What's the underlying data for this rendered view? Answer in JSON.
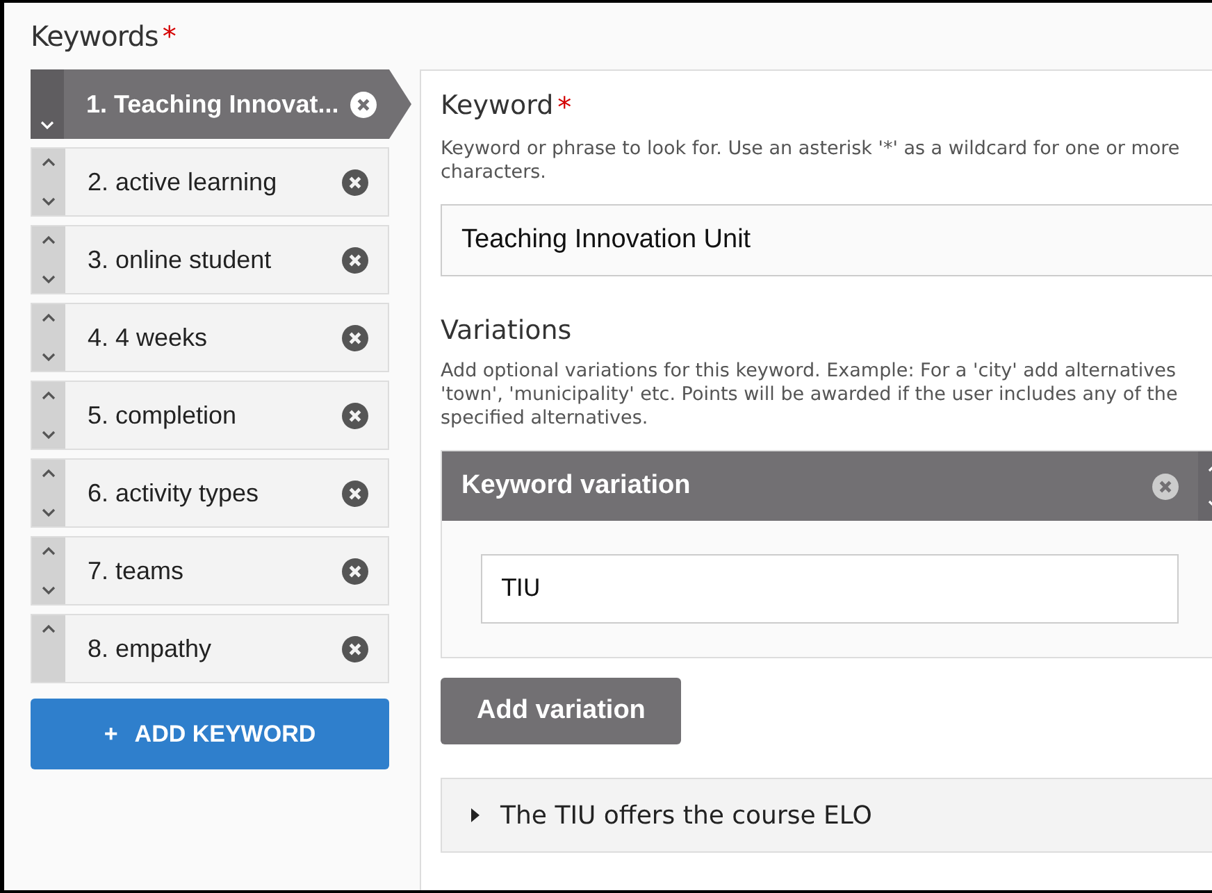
{
  "title": "Keywords",
  "required_mark": "*",
  "keywords": [
    {
      "label": "1. Teaching Innovat...",
      "selected": true
    },
    {
      "label": "2. active learning",
      "selected": false
    },
    {
      "label": "3. online student",
      "selected": false
    },
    {
      "label": "4. 4 weeks",
      "selected": false
    },
    {
      "label": "5. completion",
      "selected": false
    },
    {
      "label": "6. activity types",
      "selected": false
    },
    {
      "label": "7. teams",
      "selected": false
    },
    {
      "label": "8. empathy",
      "selected": false
    }
  ],
  "add_keyword": {
    "icon": "+",
    "label": "ADD KEYWORD"
  },
  "editor": {
    "keyword_label": "Keyword",
    "keyword_required_mark": "*",
    "keyword_help": "Keyword or phrase to look for. Use an asterisk '*' as a wildcard for one or more characters.",
    "keyword_value": "Teaching Innovation Unit",
    "variations_label": "Variations",
    "variations_help": "Add optional variations for this keyword. Example: For a 'city' add alternatives 'town', 'municipality' etc. Points will be awarded if the user includes any of the specified alternatives.",
    "variations": [
      {
        "title": "Keyword variation",
        "value": "TIU"
      }
    ],
    "add_variation": "Add variation",
    "feedback": {
      "label": "The TIU offers the course ELO",
      "expanded": false
    }
  }
}
